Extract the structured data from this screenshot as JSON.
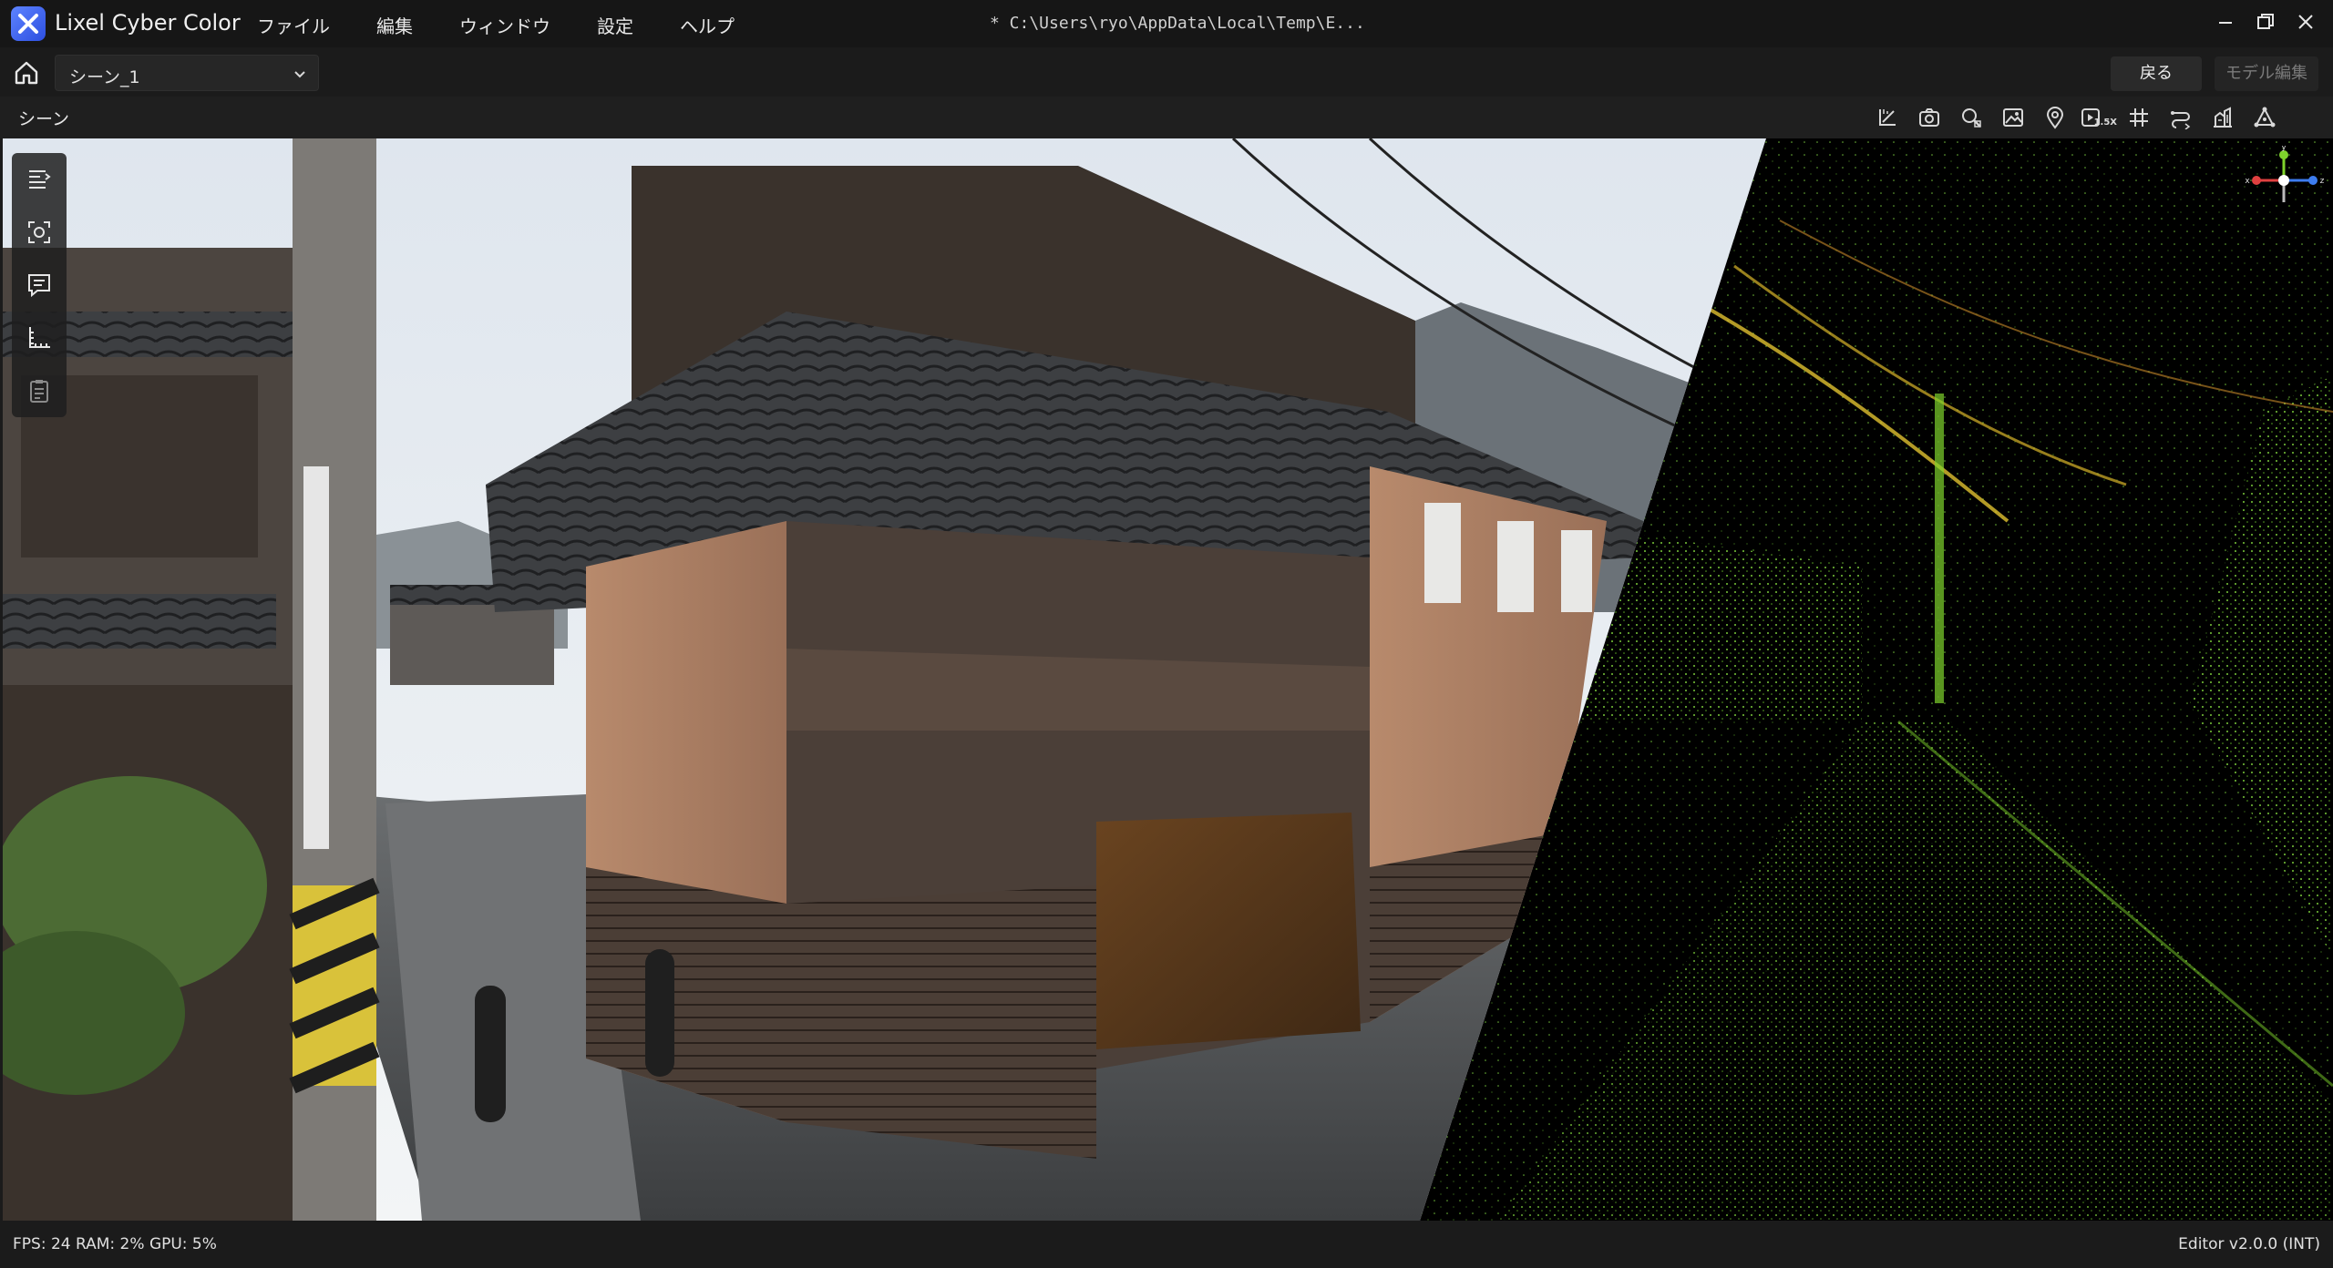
{
  "app": {
    "name": "Lixel Cyber Color",
    "title_path": "* C:\\Users\\ryo\\AppData\\Local\\Temp\\E..."
  },
  "menu": {
    "items": [
      {
        "label": "ファイル"
      },
      {
        "label": "編集"
      },
      {
        "label": "ウィンドウ"
      },
      {
        "label": "設定"
      },
      {
        "label": "ヘルプ"
      }
    ]
  },
  "window_controls": {
    "icons": [
      "minimize-icon",
      "restore-icon",
      "close-icon"
    ]
  },
  "scene_bar": {
    "scene_select_value": "シーン_1",
    "back_label": "戻る",
    "model_edit_label": "モデル編集"
  },
  "panel": {
    "title": "シーン",
    "toolbar": {
      "icons": [
        "measure-icon",
        "camera-icon",
        "search-shapes-icon",
        "image-icon",
        "location-pin-icon",
        "speed-icon",
        "grid-icon",
        "path-icon",
        "buildings-icon",
        "triangle-nodes-icon"
      ],
      "speed_label": "1.5X"
    }
  },
  "side_tools": {
    "icons": [
      "layers-menu-icon",
      "screen-capture-icon",
      "comment-icon",
      "ruler-icon",
      "clipboard-icon"
    ]
  },
  "axis": {
    "x": "x",
    "y": "y",
    "z": "z"
  },
  "status": {
    "fps": "FPS: 24",
    "ram": "RAM: 2%",
    "gpu": "GPU: 5%",
    "version": "Editor v2.0.0 (INT)"
  },
  "colors": {
    "accent": "#3f66f0",
    "background": "#1b1b1b",
    "titlebar": "#161616",
    "pointcloud_green": "#7fd32c",
    "pointcloud_yellow": "#e0c030"
  }
}
